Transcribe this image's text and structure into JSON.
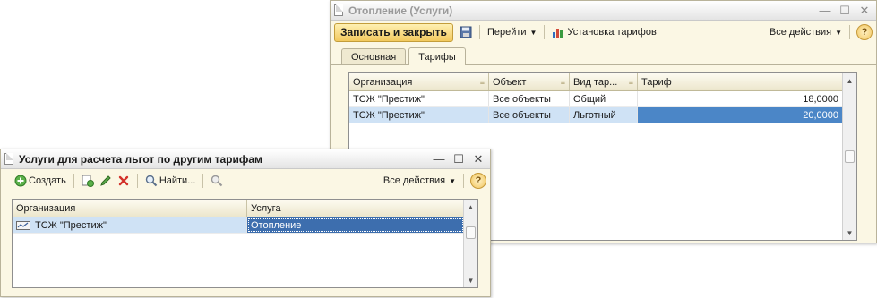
{
  "main_window": {
    "title": "Отопление (Услуги)",
    "toolbar": {
      "save_close": "Записать и закрыть",
      "goto": "Перейти",
      "tariffs": "Установка тарифов",
      "all_actions": "Все действия",
      "help": "?"
    },
    "tabs": [
      {
        "label": "Основная",
        "active": false
      },
      {
        "label": "Тарифы",
        "active": true
      }
    ],
    "columns": [
      "Организация",
      "Объект",
      "Вид тар...",
      "Тариф"
    ],
    "rows": [
      {
        "org": "ТСЖ \"Престиж\"",
        "object": "Все объекты",
        "kind": "Общий",
        "tariff": "18,0000"
      },
      {
        "org": "ТСЖ \"Престиж\"",
        "object": "Все объекты",
        "kind": "Льготный",
        "tariff": "20,0000"
      }
    ]
  },
  "sub_window": {
    "title": "Услуги для расчета льгот по другим тарифам",
    "toolbar": {
      "create": "Создать",
      "find": "Найти...",
      "all_actions": "Все действия",
      "help": "?"
    },
    "columns": [
      "Организация",
      "Услуга"
    ],
    "rows": [
      {
        "org": "ТСЖ \"Престиж\"",
        "service": "Отопление"
      }
    ]
  },
  "colors": {
    "accent_button": "#f2c95e",
    "selection": "#cfe2f5",
    "active_cell": "#4b86c7",
    "window_bg": "#fbf7e4"
  }
}
